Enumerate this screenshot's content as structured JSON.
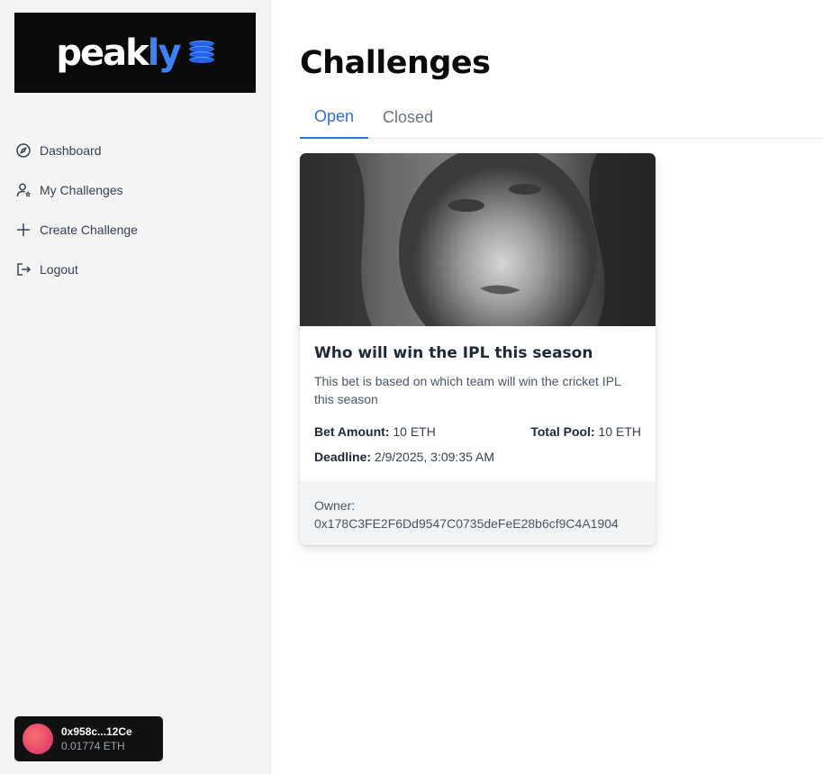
{
  "brand": {
    "name_prefix": "peak",
    "name_accent": "ly",
    "accent_color": "#3b82f6",
    "icon": "coin-stack-icon"
  },
  "sidebar": {
    "items": [
      {
        "label": "Dashboard",
        "icon": "dashboard-gauge-icon"
      },
      {
        "label": "My Challenges",
        "icon": "user-star-icon"
      },
      {
        "label": "Create Challenge",
        "icon": "plus-icon"
      },
      {
        "label": "Logout",
        "icon": "logout-icon"
      }
    ]
  },
  "wallet": {
    "address": "0x958c...12Ce",
    "balance": "0.01774 ETH",
    "avatar_color": "#e8476b"
  },
  "main": {
    "title": "Challenges",
    "tabs": [
      {
        "label": "Open",
        "active": true
      },
      {
        "label": "Closed",
        "active": false
      }
    ],
    "active_tab_color": "#2f6fd1"
  },
  "card": {
    "image": "portrait-photo",
    "title": "Who will win the IPL this season",
    "description": "This bet is based on which team will win the cricket IPL this season",
    "bet_amount_label": "Bet Amount:",
    "bet_amount_value": "10 ETH",
    "total_pool_label": "Total Pool:",
    "total_pool_value": "10 ETH",
    "deadline_label": "Deadline:",
    "deadline_value": "2/9/2025, 3:09:35 AM",
    "owner_label": "Owner:",
    "owner_value": "0x178C3FE2F6Dd9547C0735deFeE28b6cf9C4A1904"
  }
}
